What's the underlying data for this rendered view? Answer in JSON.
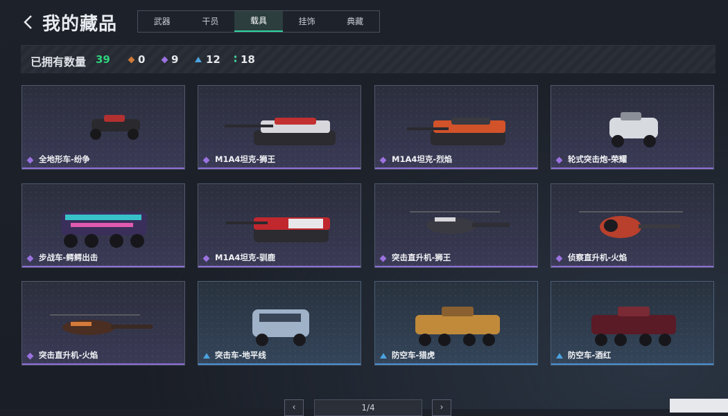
{
  "header": {
    "title": "我的藏品",
    "tabs": [
      {
        "label": "武器",
        "active": false
      },
      {
        "label": "干员",
        "active": false
      },
      {
        "label": "载具",
        "active": true
      },
      {
        "label": "挂饰",
        "active": false
      },
      {
        "label": "典藏",
        "active": false
      }
    ]
  },
  "stats": {
    "label": "已拥有数量",
    "total": "39",
    "orange": "0",
    "purple": "9",
    "blue": "12",
    "green": "18"
  },
  "colors": {
    "accent_green": "#2ed37e",
    "tab_active_underline": "#2ed3a0",
    "rarity_purple": "#9b72e0",
    "rarity_blue": "#4ba3e0",
    "rarity_orange": "#d07a3a"
  },
  "items": [
    {
      "name": "全地形车-纷争",
      "rarity": "purple",
      "vehicle": "atv"
    },
    {
      "name": "M1A4坦克-狮王",
      "rarity": "purple",
      "vehicle": "tank"
    },
    {
      "name": "M1A4坦克-烈焰",
      "rarity": "purple",
      "vehicle": "tank"
    },
    {
      "name": "轮式突击炮-荣耀",
      "rarity": "purple",
      "vehicle": "armored-car"
    },
    {
      "name": "步战车-鳄鳄出击",
      "rarity": "purple",
      "vehicle": "ifv"
    },
    {
      "name": "M1A4坦克-驯鹿",
      "rarity": "purple",
      "vehicle": "tank"
    },
    {
      "name": "突击直升机-狮王",
      "rarity": "purple",
      "vehicle": "attack-helicopter"
    },
    {
      "name": "侦察直升机-火焰",
      "rarity": "purple",
      "vehicle": "scout-helicopter"
    },
    {
      "name": "突击直升机-火焰",
      "rarity": "purple",
      "vehicle": "attack-helicopter"
    },
    {
      "name": "突击车-地平线",
      "rarity": "blue",
      "vehicle": "assault-vehicle"
    },
    {
      "name": "防空车-猎虎",
      "rarity": "blue",
      "vehicle": "aa-vehicle"
    },
    {
      "name": "防空车-酒红",
      "rarity": "blue",
      "vehicle": "aa-vehicle"
    }
  ],
  "pagination": {
    "page": "1/4",
    "prev_icon": "chevron-left-icon",
    "next_icon": "chevron-right-icon"
  }
}
